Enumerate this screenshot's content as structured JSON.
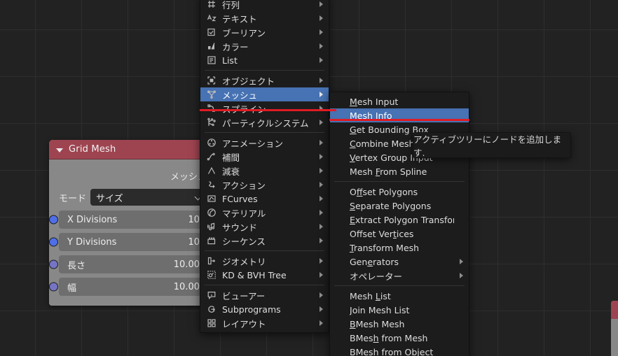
{
  "app": {
    "editor": "blender-node-editor"
  },
  "node": {
    "title": "Grid Mesh",
    "output_label": "メッシュ",
    "mode_label": "モード",
    "mode_value": "サイズ",
    "header_color": "#9e4450",
    "body_color": "#888888",
    "fields": [
      {
        "label": "X Divisions",
        "value": "10",
        "socket_color": "#4f6fe8"
      },
      {
        "label": "Y Divisions",
        "value": "10",
        "socket_color": "#4f6fe8"
      },
      {
        "label": "長さ",
        "value": "10.00",
        "socket_color": "#7575c4"
      },
      {
        "label": "幅",
        "value": "10.00",
        "socket_color": "#7575c4"
      }
    ]
  },
  "main_menu": {
    "items": [
      {
        "label": "行列",
        "icon": "matrix-icon",
        "arrow": true,
        "separator_after": false
      },
      {
        "label": "テキスト",
        "icon": "text-icon",
        "arrow": true,
        "separator_after": false
      },
      {
        "label": "ブーリアン",
        "icon": "boolean-icon",
        "arrow": true,
        "separator_after": false
      },
      {
        "label": "カラー",
        "icon": "color-icon",
        "arrow": true,
        "separator_after": false
      },
      {
        "label": "List",
        "icon": "list-icon",
        "arrow": true,
        "separator_after": true
      },
      {
        "label": "オブジェクト",
        "icon": "object-icon",
        "arrow": true,
        "separator_after": false
      },
      {
        "label": "メッシュ",
        "icon": "mesh-icon",
        "arrow": true,
        "separator_after": false,
        "selected": true
      },
      {
        "label": "スプライン",
        "icon": "spline-icon",
        "arrow": true,
        "separator_after": false
      },
      {
        "label": "パーティクルシステム",
        "icon": "particle-icon",
        "arrow": true,
        "separator_after": true
      },
      {
        "label": "アニメーション",
        "icon": "animation-icon",
        "arrow": true,
        "separator_after": false
      },
      {
        "label": "補間",
        "icon": "interpolation-icon",
        "arrow": true,
        "separator_after": false
      },
      {
        "label": "減衰",
        "icon": "falloff-icon",
        "arrow": true,
        "separator_after": false
      },
      {
        "label": "アクション",
        "icon": "action-icon",
        "arrow": true,
        "separator_after": false
      },
      {
        "label": "FCurves",
        "icon": "fcurves-icon",
        "arrow": true,
        "separator_after": false
      },
      {
        "label": "マテリアル",
        "icon": "material-icon",
        "arrow": true,
        "separator_after": false
      },
      {
        "label": "サウンド",
        "icon": "sound-icon",
        "arrow": true,
        "separator_after": false
      },
      {
        "label": "シーケンス",
        "icon": "sequence-icon",
        "arrow": true,
        "separator_after": true
      },
      {
        "label": "ジオメトリ",
        "icon": "geometry-icon",
        "arrow": true,
        "separator_after": false
      },
      {
        "label": "KD & BVH Tree",
        "icon": "kdtree-icon",
        "arrow": true,
        "separator_after": true
      },
      {
        "label": "ビューアー",
        "icon": "viewer-icon",
        "arrow": true,
        "separator_after": false
      },
      {
        "label": "Subprograms",
        "icon": "subprogram-icon",
        "arrow": true,
        "separator_after": false
      },
      {
        "label": "レイアウト",
        "icon": "layout-icon",
        "arrow": true,
        "separator_after": false
      }
    ]
  },
  "sub_menu": {
    "items": [
      {
        "label": "Mesh Input",
        "accel": 0,
        "arrow": false,
        "separator_after": false
      },
      {
        "label": "Mesh Info",
        "accel": 5,
        "arrow": false,
        "separator_after": false,
        "selected": true
      },
      {
        "label": "Get Bounding Box",
        "accel": 0,
        "arrow": false,
        "separator_after": false
      },
      {
        "label": "Combine Mesh",
        "accel": 0,
        "arrow": false,
        "separator_after": false
      },
      {
        "label": "Vertex Group Input",
        "accel": 0,
        "arrow": false,
        "separator_after": false
      },
      {
        "label": "Mesh From Spline",
        "accel": 5,
        "arrow": false,
        "separator_after": true
      },
      {
        "label": "Offset Polygons",
        "accel": 1,
        "arrow": false,
        "separator_after": false
      },
      {
        "label": "Separate Polygons",
        "accel": 0,
        "arrow": false,
        "separator_after": false
      },
      {
        "label": "Extract Polygon Transforms",
        "accel": 0,
        "arrow": false,
        "separator_after": false
      },
      {
        "label": "Offset Vertices",
        "accel": 10,
        "arrow": false,
        "separator_after": false
      },
      {
        "label": "Transform Mesh",
        "accel": 0,
        "arrow": false,
        "separator_after": false
      },
      {
        "label": "Generators",
        "accel": 3,
        "arrow": true,
        "separator_after": false
      },
      {
        "label": "オペレーター",
        "accel": -1,
        "arrow": true,
        "separator_after": true
      },
      {
        "label": "Mesh List",
        "accel": 5,
        "arrow": false,
        "separator_after": false
      },
      {
        "label": "Join Mesh List",
        "accel": 0,
        "arrow": false,
        "separator_after": false
      },
      {
        "label": "BMesh Mesh",
        "accel": 0,
        "arrow": false,
        "separator_after": false
      },
      {
        "label": "BMesh from Mesh",
        "accel": 4,
        "arrow": false,
        "separator_after": false
      },
      {
        "label": "BMesh from Object",
        "accel": -1,
        "arrow": false,
        "separator_after": false
      }
    ]
  },
  "tooltip": {
    "text": "アクティブツリーにノードを追加します."
  },
  "colors": {
    "highlight": "#4772b3",
    "annotation": "#e01b24",
    "menu_bg": "#1c1c1c",
    "canvas_bg": "#222222"
  }
}
